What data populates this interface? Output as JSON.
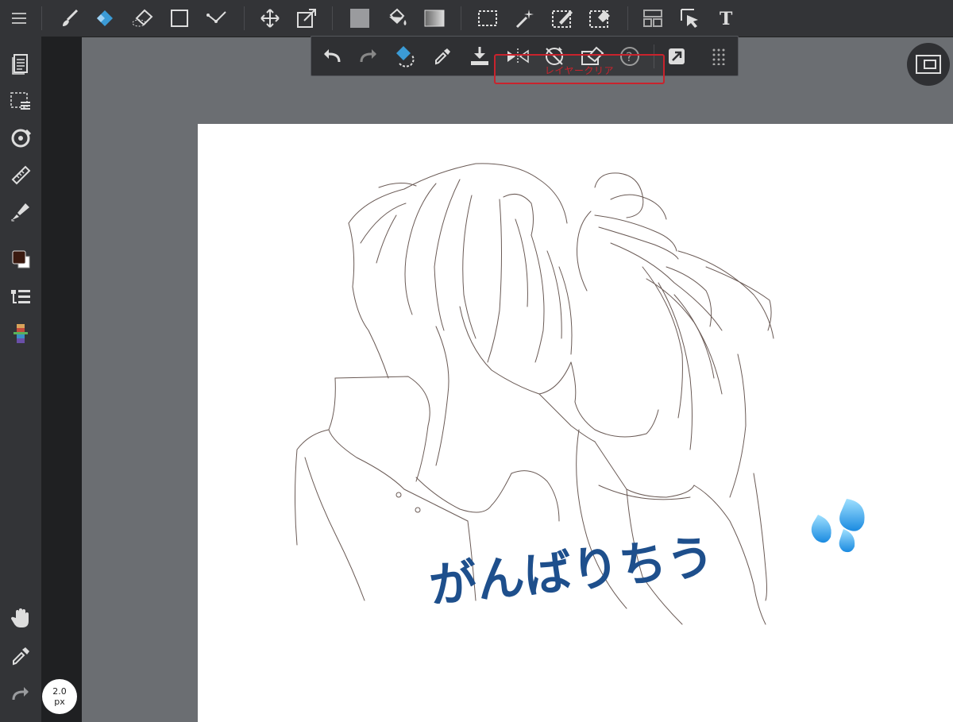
{
  "toolbar": {
    "items": [
      "menu-icon",
      "brush-icon",
      "eraser-icon",
      "blur-icon",
      "shape-icon",
      "pen-curve-icon",
      "move-icon",
      "transform-icon",
      "fill-color-icon",
      "bucket-icon",
      "gradient-icon",
      "select-rect-icon",
      "magic-wand-icon",
      "select-pen-icon",
      "select-eraser-icon",
      "layout-icon",
      "select-layer-icon",
      "text-icon"
    ]
  },
  "sidebar": {
    "items": [
      "pages-icon",
      "selection-icon",
      "snap-icon",
      "ruler-icon",
      "brush-settings-icon",
      "color-icon",
      "layers-icon",
      "palette-icon",
      "hand-icon",
      "eyedropper-icon",
      "redo-icon"
    ],
    "primary_color": "#3a1a10",
    "secondary_color": "#ffffff"
  },
  "subbar": {
    "items": [
      "undo-icon",
      "redo-icon",
      "fill-select-icon",
      "eyedropper-icon",
      "download-icon",
      "flip-icon",
      "rotate-off-icon",
      "clear-layer-icon",
      "help-icon",
      "export-icon",
      "more-icon"
    ]
  },
  "tooltip": {
    "text": "レイヤークリア"
  },
  "brush": {
    "size_value": "2.0",
    "size_unit": "px"
  },
  "canvas": {
    "caption": "がんばりちう",
    "caption_color": "#1e4f8c",
    "stroke_color": "#6a5a55"
  }
}
